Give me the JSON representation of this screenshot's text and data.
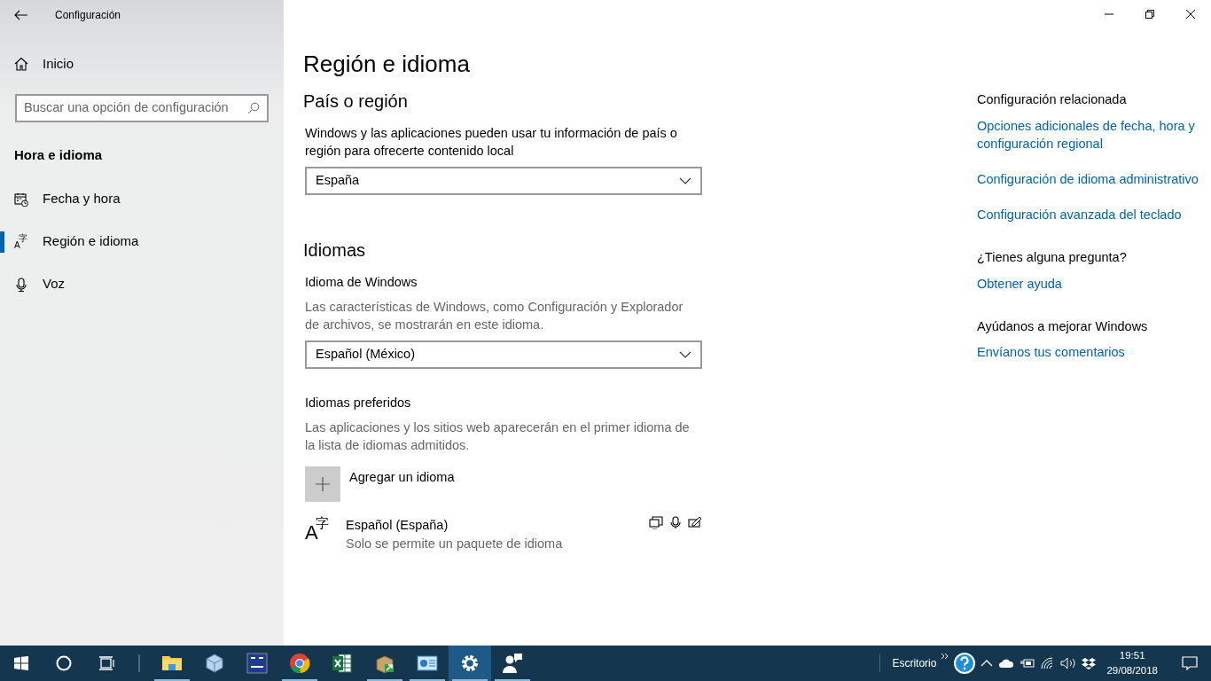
{
  "window": {
    "title": "Configuración"
  },
  "sidebar": {
    "home": "Inicio",
    "search": {
      "placeholder": "Buscar una opción de configuración"
    },
    "section": "Hora e idioma",
    "items": [
      {
        "label": "Fecha y hora",
        "selected": false
      },
      {
        "label": "Región e idioma",
        "selected": true,
        "icon_chars": [
          "A",
          "字"
        ]
      },
      {
        "label": "Voz",
        "selected": false
      }
    ]
  },
  "main": {
    "title": "Región e idioma",
    "country": {
      "heading": "País o región",
      "description": "Windows y las aplicaciones pueden usar tu información de país o región para ofrecerte contenido local",
      "value": "España"
    },
    "languages": {
      "heading": "Idiomas",
      "windows_language": {
        "label": "Idioma de Windows",
        "description": "Las características de Windows, como Configuración y Explorador de archivos, se mostrarán en este idioma.",
        "value": "Español (México)"
      },
      "preferred": {
        "label": "Idiomas preferidos",
        "description": "Las aplicaciones y los sitios web aparecerán en el primer idioma de la lista de idiomas admitidos.",
        "add_label": "Agregar un idioma",
        "items": [
          {
            "name": "Español (España)",
            "note": "Solo se permite un paquete de idioma",
            "icon_chars": [
              "A",
              "字"
            ]
          }
        ]
      }
    }
  },
  "related": [
    {
      "heading": "Configuración relacionada",
      "links": [
        "Opciones adicionales de fecha, hora y configuración regional",
        "Configuración de idioma administrativo",
        "Configuración avanzada del teclado"
      ]
    },
    {
      "heading": "¿Tienes alguna pregunta?",
      "links": [
        "Obtener ayuda"
      ]
    },
    {
      "heading": "Ayúdanos a mejorar Windows",
      "links": [
        "Envíanos tus comentarios"
      ]
    }
  ],
  "taskbar": {
    "apps": [
      {
        "running": true,
        "active": false
      },
      {
        "running": false,
        "active": false
      },
      {
        "running": false,
        "active": false
      },
      {
        "running": true,
        "active": false
      },
      {
        "running": false,
        "active": false
      },
      {
        "running": true,
        "active": false
      },
      {
        "running": true,
        "active": false
      },
      {
        "running": true,
        "active": true
      },
      {
        "running": true,
        "active": false
      }
    ],
    "toolbar_label": "Escritorio",
    "time": "19:51",
    "date": "29/08/2018"
  }
}
